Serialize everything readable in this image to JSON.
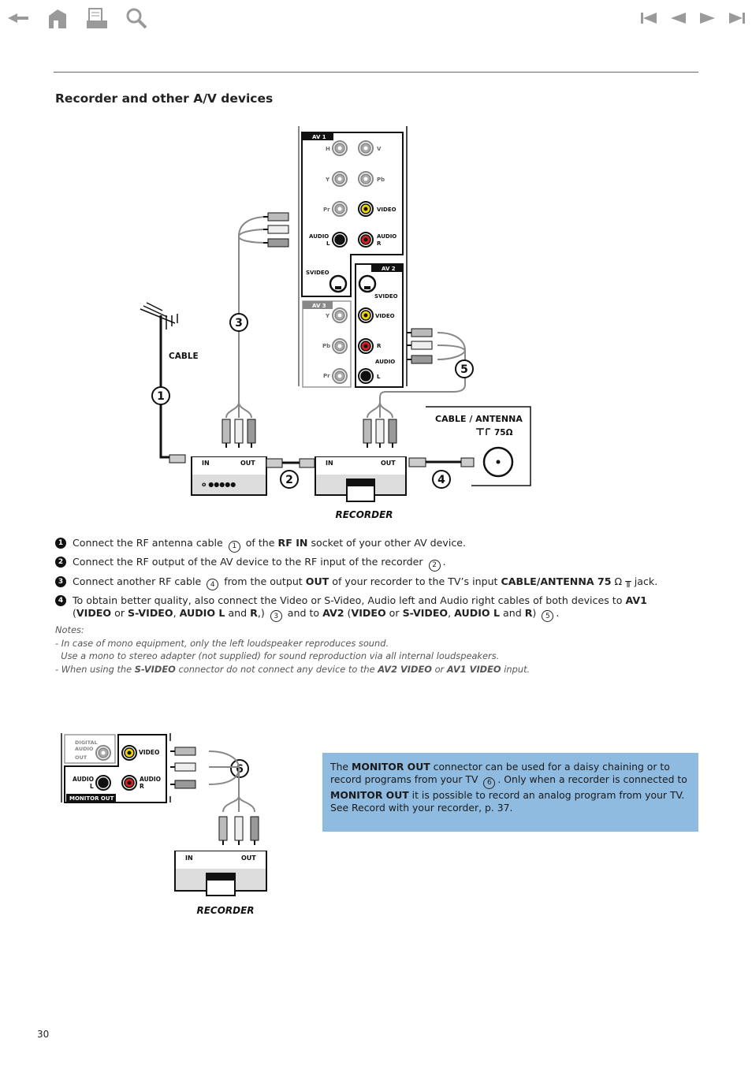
{
  "nav": {
    "left_icons": [
      "back-arrow-icon",
      "home-icon",
      "print-icon",
      "search-icon"
    ],
    "right_icons": [
      "first-page-icon",
      "previous-page-icon",
      "next-page-icon",
      "last-page-icon"
    ],
    "icon_color": "#9a9a9a"
  },
  "title": "Recorder and other A/V devices",
  "diagram": {
    "av1": "AV 1",
    "av2": "AV 2",
    "av3": "AV 3",
    "h": "H",
    "v": "V",
    "y": "Y",
    "pb": "Pb",
    "pr": "Pr",
    "video": "VIDEO",
    "audio": "AUDIO",
    "l": "L",
    "r": "R",
    "svideo": "SVIDEO",
    "cable": "CABLE",
    "cable_antenna": "CABLE / ANTENNA",
    "ohm": "75Ω",
    "in": "IN",
    "out": "OUT",
    "recorder": "RECORDER",
    "refs": [
      "1",
      "2",
      "3",
      "4",
      "5"
    ],
    "digital_audio_out": [
      "DIGITAL",
      "AUDIO",
      "OUT"
    ],
    "monitor_out": "MONITOR OUT",
    "ref6": "6"
  },
  "colors": {
    "video_jack": "#f2d400",
    "audio_r_jack": "#d8201f",
    "info_box": "#8fbbe0"
  },
  "steps": [
    {
      "n": "1",
      "parts": [
        {
          "t": "Connect the RF antenna cable "
        },
        {
          "r": "1"
        },
        {
          "t": " of the "
        },
        {
          "t": "RF IN",
          "b": true
        },
        {
          "t": " socket of your other AV device."
        }
      ]
    },
    {
      "n": "2",
      "parts": [
        {
          "t": "Connect the RF output of the AV device to the RF input of the recorder "
        },
        {
          "r": "2"
        },
        {
          "t": "."
        }
      ]
    },
    {
      "n": "3",
      "parts": [
        {
          "t": "Connect another RF cable "
        },
        {
          "r": "4"
        },
        {
          "t": " from the output "
        },
        {
          "t": "OUT",
          "b": true
        },
        {
          "t": " of your recorder to the TV’s input "
        },
        {
          "t": "CABLE/ANTENNA 75",
          "b": true
        },
        {
          "t": " Ω ╥ jack."
        }
      ]
    },
    {
      "n": "4",
      "parts": [
        {
          "t": "To obtain better quality, also connect the Video or S-Video, Audio left and Audio right cables of both devices to "
        },
        {
          "t": "AV1",
          "b": true
        },
        {
          "t": " ("
        },
        {
          "t": "VIDEO",
          "b": true
        },
        {
          "t": " or "
        },
        {
          "t": "S-VIDEO",
          "b": true
        },
        {
          "t": ", "
        },
        {
          "t": "AUDIO L",
          "b": true
        },
        {
          "t": " and "
        },
        {
          "t": "R",
          "b": true
        },
        {
          "t": ",) "
        },
        {
          "r": "3"
        },
        {
          "t": " and to "
        },
        {
          "t": "AV2",
          "b": true
        },
        {
          "t": " ("
        },
        {
          "t": "VIDEO",
          "b": true
        },
        {
          "t": " or "
        },
        {
          "t": "S-VIDEO",
          "b": true
        },
        {
          "t": ",  "
        },
        {
          "t": "AUDIO L",
          "b": true
        },
        {
          "t": " and "
        },
        {
          "t": "R",
          "b": true
        },
        {
          "t": ") "
        },
        {
          "r": "5"
        },
        {
          "t": "."
        }
      ]
    }
  ],
  "notes": [
    [
      {
        "t": "Notes:"
      }
    ],
    [
      {
        "t": "- In case of mono equipment, only the left loudspeaker reproduces sound."
      }
    ],
    [
      {
        "t": "  Use a mono to stereo adapter (not supplied) for sound reproduction via all internal loudspeakers."
      }
    ],
    [
      {
        "t": "- When using the "
      },
      {
        "t": "S-VIDEO",
        "b": true
      },
      {
        "t": " connector do not connect any device to the "
      },
      {
        "t": "AV2 VIDEO",
        "b": true
      },
      {
        "t": " or "
      },
      {
        "t": "AV1 VIDEO",
        "b": true
      },
      {
        "t": " input."
      }
    ]
  ],
  "info": [
    {
      "t": "The "
    },
    {
      "t": "MONITOR OUT",
      "b": true
    },
    {
      "t": " connector can be used for a daisy chaining or to record programs from your TV "
    },
    {
      "r": "6"
    },
    {
      "t": ". Only when a recorder is connected to "
    },
    {
      "t": "MONITOR OUT",
      "b": true
    },
    {
      "t": " it is possible to record an analog program from your TV. See Record with your recorder, p. 37."
    }
  ],
  "page_number": "30"
}
